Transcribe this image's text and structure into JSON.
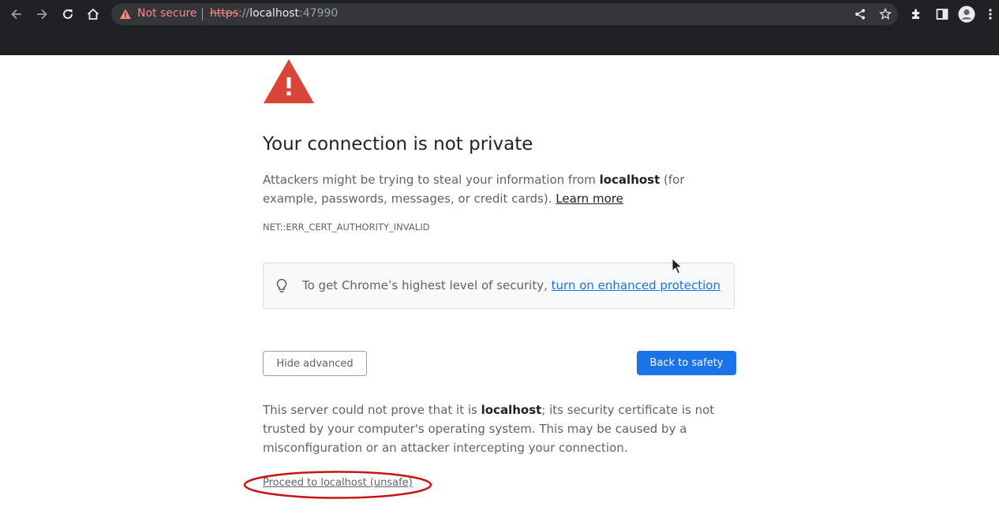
{
  "browser": {
    "omnibox": {
      "security_label": "Not secure",
      "url_scheme": "https",
      "url_separator": "://",
      "url_host": "localhost",
      "url_port": ":47990"
    },
    "icons": [
      "back-icon",
      "forward-icon",
      "reload-icon",
      "home-icon",
      "warning-icon",
      "share-icon",
      "star-icon",
      "extensions-icon",
      "side-panel-icon",
      "profile-icon",
      "menu-icon"
    ]
  },
  "interstitial": {
    "heading": "Your connection is not private",
    "intro_part1": "Attackers might be trying to steal your information from ",
    "intro_host": "localhost",
    "intro_part2": " (for example, passwords, messages, or credit cards). ",
    "learn_more": "Learn more",
    "error_code": "NET::ERR_CERT_AUTHORITY_INVALID",
    "protection_text": "To get Chrome’s highest level of security, ",
    "protection_link": "turn on enhanced protection",
    "hide_advanced": "Hide advanced",
    "back_to_safety": "Back to safety",
    "details_part1": "This server could not prove that it is ",
    "details_host": "localhost",
    "details_part2": "; its security certificate is not trusted by your computer's operating system. This may be caused by a misconfiguration or an attacker intercepting your connection.",
    "proceed_link": "Proceed to localhost (unsafe)"
  },
  "colors": {
    "danger_red": "#db4437",
    "primary_blue": "#1a73e8",
    "chrome_dark": "#202124",
    "annotation_red": "#cc1111"
  }
}
